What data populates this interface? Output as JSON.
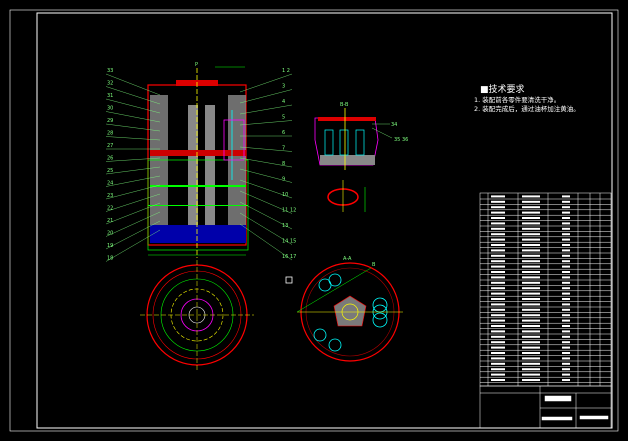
{
  "tech_requirements": {
    "title": "■技术要求",
    "notes": [
      "1. 装配前各零件要清洗干净。",
      "2. 装配完成后，通过油杯加注黄油。"
    ]
  },
  "main_view": {
    "top_label": "P",
    "left_labels": [
      "33",
      "32",
      "31",
      "30",
      "29",
      "28",
      "27",
      "26",
      "25",
      "24",
      "23",
      "22",
      "21",
      "20",
      "19",
      "18"
    ],
    "right_labels": [
      "1 2",
      "3",
      "4",
      "5",
      "6",
      "7",
      "8",
      "9",
      "10",
      "11 12",
      "13",
      "14 15",
      "16 17"
    ],
    "section_marker": "A"
  },
  "section_bb": {
    "title": "B-B",
    "labels": [
      "34",
      "35 36"
    ]
  },
  "section_aa": {
    "title": "A-A",
    "marker": "B"
  },
  "colors": {
    "outline": "#ff0000",
    "center": "#ffff00",
    "dim": "#00ff00",
    "hatch": "#c0c0c0",
    "leader": "#7fff7f",
    "bearing": "#00ffff",
    "detail": "#ff00ff",
    "base": "#0000cc"
  }
}
